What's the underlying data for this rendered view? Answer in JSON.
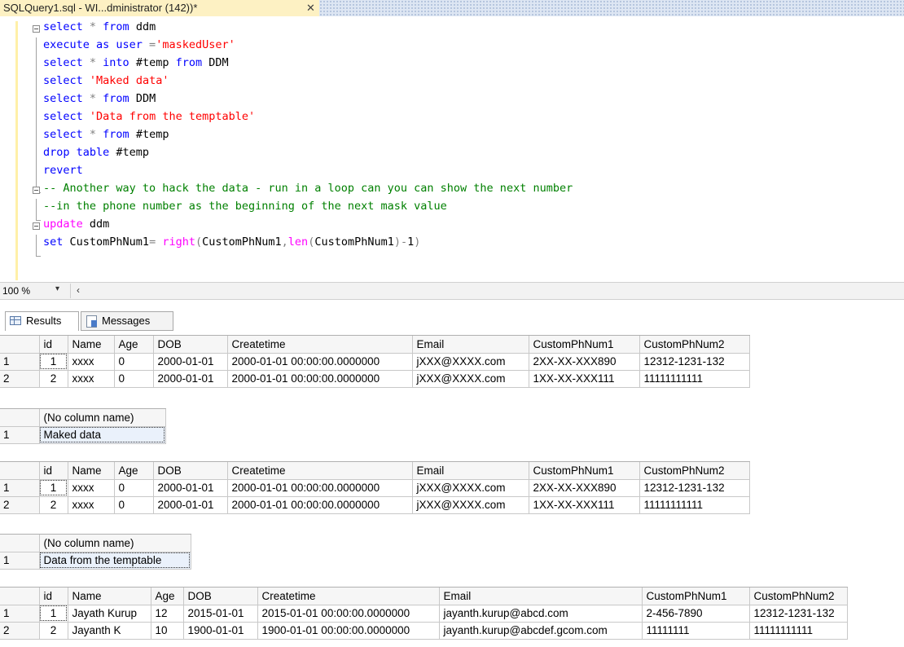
{
  "tab": {
    "title": "SQLQuery1.sql - WI...dministrator (142))*",
    "close": "✕"
  },
  "editor": {
    "lines": [
      [
        {
          "c": "kw",
          "t": "select"
        },
        {
          "c": "gr",
          "t": " * "
        },
        {
          "c": "kw",
          "t": "from"
        },
        {
          "c": "",
          "t": " ddm"
        }
      ],
      [
        {
          "c": "kw",
          "t": "execute as user"
        },
        {
          "c": "gr",
          "t": " ="
        },
        {
          "c": "str",
          "t": "'maskedUser'"
        }
      ],
      [
        {
          "c": "kw",
          "t": "select"
        },
        {
          "c": "gr",
          "t": " * "
        },
        {
          "c": "kw",
          "t": "into"
        },
        {
          "c": "",
          "t": " #temp "
        },
        {
          "c": "kw",
          "t": "from"
        },
        {
          "c": "",
          "t": " DDM"
        }
      ],
      [
        {
          "c": "kw",
          "t": "select"
        },
        {
          "c": "",
          "t": " "
        },
        {
          "c": "str",
          "t": "'Maked data'"
        }
      ],
      [
        {
          "c": "kw",
          "t": "select"
        },
        {
          "c": "gr",
          "t": " * "
        },
        {
          "c": "kw",
          "t": "from"
        },
        {
          "c": "",
          "t": " DDM"
        }
      ],
      [
        {
          "c": "kw",
          "t": "select"
        },
        {
          "c": "",
          "t": " "
        },
        {
          "c": "str",
          "t": "'Data from the temptable'"
        }
      ],
      [
        {
          "c": "kw",
          "t": "select"
        },
        {
          "c": "gr",
          "t": " * "
        },
        {
          "c": "kw",
          "t": "from"
        },
        {
          "c": "",
          "t": " #temp"
        }
      ],
      [
        {
          "c": "kw",
          "t": "drop table"
        },
        {
          "c": "",
          "t": " #temp"
        }
      ],
      [
        {
          "c": "kw",
          "t": "revert"
        }
      ],
      [
        {
          "c": "cm",
          "t": "-- Another way to hack the data - run in a loop can you can show the next number"
        }
      ],
      [
        {
          "c": "cm",
          "t": "--in the phone number as the beginning of the next mask value"
        }
      ],
      [
        {
          "c": "fn",
          "t": "update"
        },
        {
          "c": "",
          "t": " ddm"
        }
      ],
      [
        {
          "c": "kw",
          "t": "set"
        },
        {
          "c": "",
          "t": " CustomPhNum1"
        },
        {
          "c": "gr",
          "t": "= "
        },
        {
          "c": "fn",
          "t": "right"
        },
        {
          "c": "gr",
          "t": "("
        },
        {
          "c": "",
          "t": "CustomPhNum1"
        },
        {
          "c": "gr",
          "t": ","
        },
        {
          "c": "fn",
          "t": "len"
        },
        {
          "c": "gr",
          "t": "("
        },
        {
          "c": "",
          "t": "CustomPhNum1"
        },
        {
          "c": "gr",
          "t": ")-"
        },
        {
          "c": "",
          "t": "1"
        },
        {
          "c": "gr",
          "t": ")"
        }
      ]
    ]
  },
  "zoom": {
    "value": "100 %",
    "dropdown": "▾",
    "scroll": "‹"
  },
  "results_tabs": {
    "results": "Results",
    "messages": "Messages"
  },
  "results": [
    {
      "columns": [
        "id",
        "Name",
        "Age",
        "DOB",
        "Createtime",
        "Email",
        "CustomPhNum1",
        "CustomPhNum2"
      ],
      "rows": [
        [
          "1",
          "xxxx",
          "0",
          "2000-01-01",
          "2000-01-01 00:00:00.0000000",
          "jXXX@XXXX.com",
          "2XX-XX-XXX890",
          "12312-1231-132"
        ],
        [
          "2",
          "xxxx",
          "0",
          "2000-01-01",
          "2000-01-01 00:00:00.0000000",
          "jXXX@XXXX.com",
          "1XX-XX-XXX111",
          "11111111111"
        ]
      ]
    },
    {
      "columns": [
        "(No column name)"
      ],
      "rows": [
        [
          "Maked data"
        ]
      ]
    },
    {
      "columns": [
        "id",
        "Name",
        "Age",
        "DOB",
        "Createtime",
        "Email",
        "CustomPhNum1",
        "CustomPhNum2"
      ],
      "rows": [
        [
          "1",
          "xxxx",
          "0",
          "2000-01-01",
          "2000-01-01 00:00:00.0000000",
          "jXXX@XXXX.com",
          "2XX-XX-XXX890",
          "12312-1231-132"
        ],
        [
          "2",
          "xxxx",
          "0",
          "2000-01-01",
          "2000-01-01 00:00:00.0000000",
          "jXXX@XXXX.com",
          "1XX-XX-XXX111",
          "11111111111"
        ]
      ]
    },
    {
      "columns": [
        "(No column name)"
      ],
      "rows": [
        [
          "Data from the temptable"
        ]
      ]
    },
    {
      "columns": [
        "id",
        "Name",
        "Age",
        "DOB",
        "Createtime",
        "Email",
        "CustomPhNum1",
        "CustomPhNum2"
      ],
      "rows": [
        [
          "1",
          "Jayath Kurup",
          "12",
          "2015-01-01",
          "2015-01-01 00:00:00.0000000",
          "jayanth.kurup@abcd.com",
          "2-456-7890",
          "12312-1231-132"
        ],
        [
          "2",
          "Jayanth K",
          "10",
          "1900-01-01",
          "1900-01-01 00:00:00.0000000",
          "jayanth.kurup@abcdef.gcom.com",
          "11111111",
          "11111111111"
        ]
      ]
    }
  ]
}
